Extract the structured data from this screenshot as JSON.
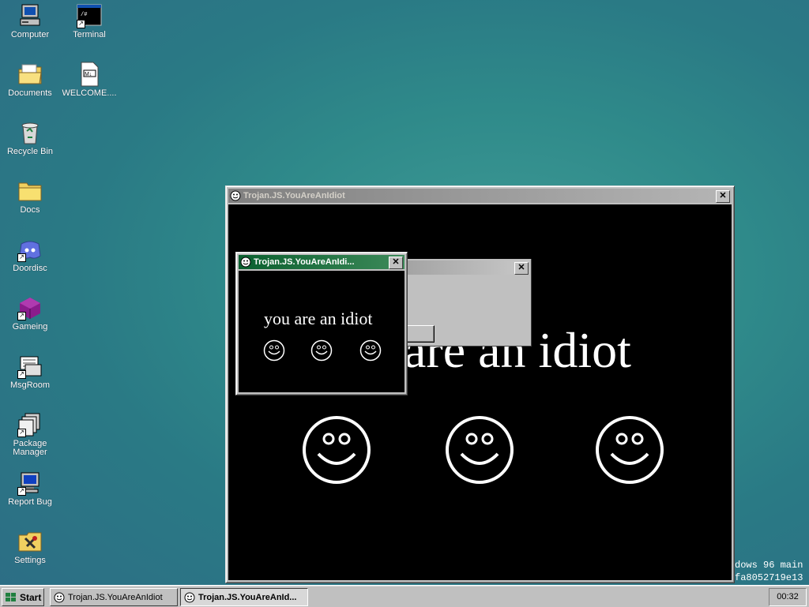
{
  "desktop_icons": [
    {
      "label": "Computer",
      "icon": "computer-icon"
    },
    {
      "label": "Terminal",
      "icon": "terminal-icon"
    },
    {
      "label": "Documents",
      "icon": "folder-documents-icon"
    },
    {
      "label": "WELCOME....",
      "icon": "markdown-file-icon"
    },
    {
      "label": "Recycle Bin",
      "icon": "recycle-bin-icon"
    },
    {
      "label": "Docs",
      "icon": "folder-icon"
    },
    {
      "label": "Doordisc",
      "icon": "discord-icon"
    },
    {
      "label": "Gameing",
      "icon": "cube-icon"
    },
    {
      "label": "MsgRoom",
      "icon": "chat-icon"
    },
    {
      "label": "Package Manager",
      "icon": "package-icon"
    },
    {
      "label": "Report Bug",
      "icon": "monitor-icon"
    },
    {
      "label": "Settings",
      "icon": "settings-icon"
    }
  ],
  "big_window": {
    "title": "Trojan.JS.YouAreAnIdiot",
    "text": "are an idiot",
    "close_label": "✕"
  },
  "small_window": {
    "title": "Trojan.JS.YouAreAnIdi...",
    "text": "you are an idiot",
    "close_label": "✕"
  },
  "gray_dialog": {
    "close_label": "✕"
  },
  "console": {
    "line1": "dows 96 main",
    "line2": "fa8052719e13"
  },
  "taskbar": {
    "start_label": "Start",
    "items": [
      {
        "label": "Trojan.JS.YouAreAnIdiot"
      },
      {
        "label": "Trojan.JS.YouAreAnId..."
      }
    ],
    "clock": "00:32"
  }
}
